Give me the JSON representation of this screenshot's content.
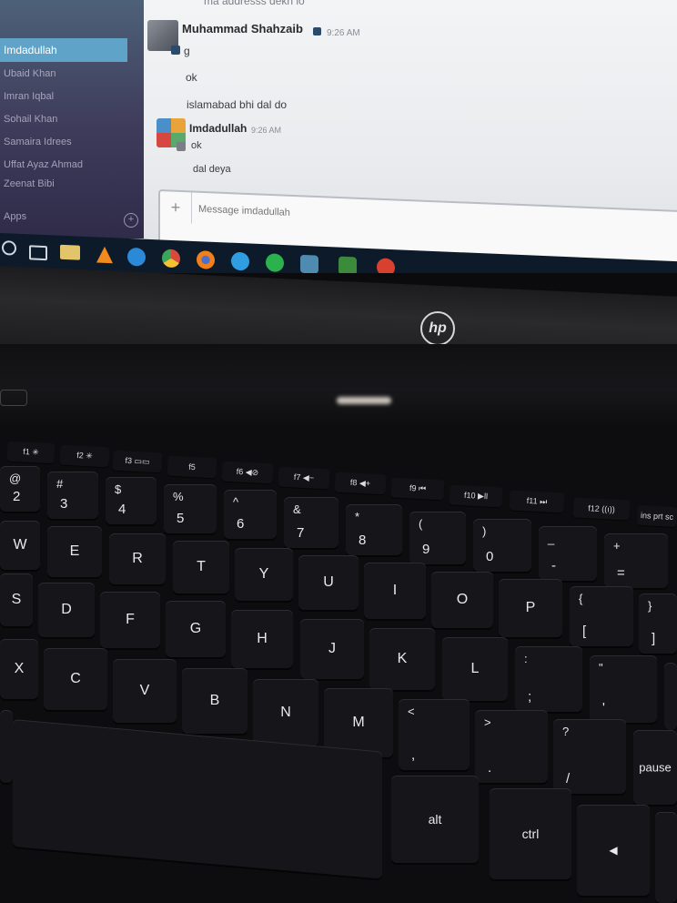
{
  "sidebar": {
    "active_channel": "Imdadullah",
    "contacts": [
      "Ubaid Khan",
      "Imran Iqbal",
      "Sohail Khan",
      "Samaira Idrees",
      "Uffat Ayaz Ahmad",
      "Zeenat Bibi"
    ],
    "apps_label": "Apps"
  },
  "chat": {
    "top_message": "ma addresss dekh lo",
    "messages": [
      {
        "author": "Muhammad Shahzaib",
        "time": "9:26 AM",
        "lines": [
          "g",
          "ok",
          "islamabad bhi dal  do"
        ]
      },
      {
        "author": "Imdadullah",
        "time": "9:26 AM",
        "lines": [
          "ok",
          "dal deya"
        ]
      }
    ],
    "composer_placeholder": "Message imdadullah"
  },
  "laptop": {
    "brand": "hp"
  },
  "keyboard": {
    "fn_row": [
      "f1 ✳",
      "f2 ✳",
      "f3 ▭▭",
      "f5",
      "f6 ◀⊘",
      "f7 ◀−",
      "f8 ◀+",
      "f9 ⏮",
      "f10 ▶ll",
      "f11 ⏭",
      "f12 ((ı))",
      "ins prt sc"
    ],
    "num_row": [
      [
        "@",
        "2"
      ],
      [
        "#",
        "3"
      ],
      [
        "$",
        "4"
      ],
      [
        "%",
        "5"
      ],
      [
        "^",
        "6"
      ],
      [
        "&",
        "7"
      ],
      [
        "*",
        "8"
      ],
      [
        "(",
        "9"
      ],
      [
        ")",
        "0"
      ],
      [
        "_",
        "-"
      ],
      [
        "+",
        "="
      ]
    ],
    "row_q": [
      "W",
      "E",
      "R",
      "T",
      "Y",
      "U",
      "I",
      "O",
      "P"
    ],
    "row_q_sym": [
      [
        "{",
        "["
      ],
      [
        "}",
        "]"
      ]
    ],
    "row_a": [
      "S",
      "D",
      "F",
      "G",
      "H",
      "J",
      "K",
      "L"
    ],
    "row_a_sym": [
      [
        ":",
        ";"
      ],
      [
        "\"",
        "'"
      ]
    ],
    "row_z": [
      "X",
      "C",
      "V",
      "B",
      "N",
      "M"
    ],
    "row_z_sym": [
      [
        "<",
        ","
      ],
      [
        ">",
        "."
      ],
      [
        "?",
        "/"
      ]
    ],
    "pause_label": "pause",
    "alt_label": "alt",
    "ctrl_label": "ctrl",
    "arrow_left": "◀"
  }
}
